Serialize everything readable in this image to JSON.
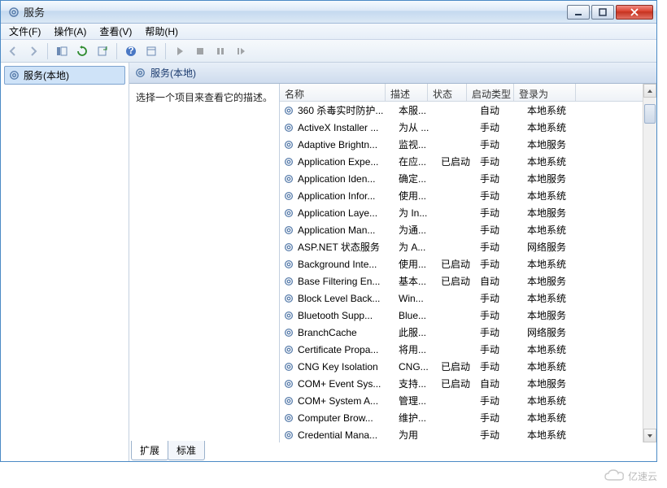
{
  "window": {
    "title": "服务"
  },
  "menu": {
    "file": "文件(F)",
    "action": "操作(A)",
    "view": "查看(V)",
    "help": "帮助(H)"
  },
  "nav": {
    "item": "服务(本地)"
  },
  "pane": {
    "heading": "服务(本地)",
    "prompt": "选择一个项目来查看它的描述。"
  },
  "columns": {
    "name": "名称",
    "desc": "描述",
    "status": "状态",
    "startup": "启动类型",
    "logon": "登录为"
  },
  "tabs": {
    "extended": "扩展",
    "standard": "标准"
  },
  "services": [
    {
      "name": "360 杀毒实时防护...",
      "desc": "本服...",
      "status": "",
      "startup": "自动",
      "logon": "本地系统"
    },
    {
      "name": "ActiveX Installer ...",
      "desc": "为从 ...",
      "status": "",
      "startup": "手动",
      "logon": "本地系统"
    },
    {
      "name": "Adaptive Brightn...",
      "desc": "监视...",
      "status": "",
      "startup": "手动",
      "logon": "本地服务"
    },
    {
      "name": "Application Expe...",
      "desc": "在应...",
      "status": "已启动",
      "startup": "手动",
      "logon": "本地系统"
    },
    {
      "name": "Application Iden...",
      "desc": "确定...",
      "status": "",
      "startup": "手动",
      "logon": "本地服务"
    },
    {
      "name": "Application Infor...",
      "desc": "使用...",
      "status": "",
      "startup": "手动",
      "logon": "本地系统"
    },
    {
      "name": "Application Laye...",
      "desc": "为 In...",
      "status": "",
      "startup": "手动",
      "logon": "本地服务"
    },
    {
      "name": "Application Man...",
      "desc": "为通...",
      "status": "",
      "startup": "手动",
      "logon": "本地系统"
    },
    {
      "name": "ASP.NET 状态服务",
      "desc": "为 A...",
      "status": "",
      "startup": "手动",
      "logon": "网络服务"
    },
    {
      "name": "Background Inte...",
      "desc": "使用...",
      "status": "已启动",
      "startup": "手动",
      "logon": "本地系统"
    },
    {
      "name": "Base Filtering En...",
      "desc": "基本...",
      "status": "已启动",
      "startup": "自动",
      "logon": "本地服务"
    },
    {
      "name": "Block Level Back...",
      "desc": "Win...",
      "status": "",
      "startup": "手动",
      "logon": "本地系统"
    },
    {
      "name": "Bluetooth Supp...",
      "desc": "Blue...",
      "status": "",
      "startup": "手动",
      "logon": "本地服务"
    },
    {
      "name": "BranchCache",
      "desc": "此服...",
      "status": "",
      "startup": "手动",
      "logon": "网络服务"
    },
    {
      "name": "Certificate Propa...",
      "desc": "将用...",
      "status": "",
      "startup": "手动",
      "logon": "本地系统"
    },
    {
      "name": "CNG Key Isolation",
      "desc": "CNG...",
      "status": "已启动",
      "startup": "手动",
      "logon": "本地系统"
    },
    {
      "name": "COM+ Event Sys...",
      "desc": "支持...",
      "status": "已启动",
      "startup": "自动",
      "logon": "本地服务"
    },
    {
      "name": "COM+ System A...",
      "desc": "管理...",
      "status": "",
      "startup": "手动",
      "logon": "本地系统"
    },
    {
      "name": "Computer Brow...",
      "desc": "维护...",
      "status": "",
      "startup": "手动",
      "logon": "本地系统"
    },
    {
      "name": "Credential Mana...",
      "desc": "为用",
      "status": "",
      "startup": "手动",
      "logon": "本地系统"
    }
  ],
  "watermark": "亿速云"
}
